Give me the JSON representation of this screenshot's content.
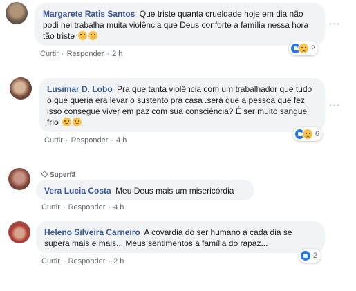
{
  "comments": [
    {
      "author": "Margarete Ratis Santos",
      "text": "Que triste quanta crueldade hoje em dia não podi nei trabalha muita violência que Deus conforte a família nessa hora tão triste",
      "emoji": [
        "sad-face",
        "sad-face"
      ],
      "actions": {
        "like": "Curtir",
        "reply": "Responder",
        "time": "2 h"
      },
      "reactions": {
        "icons": [
          "like",
          "sad"
        ],
        "count": "2"
      },
      "more": "···"
    },
    {
      "author": "Lusimar D. Lobo",
      "text": "Pra que tanta violência com um trabalhador que tudo o que queria era levar o sustento pra casa .será que a pessoa que fez isso consegue viver em paz com sua consciência? É ser muito sangue frio",
      "emoji": [
        "sad-face",
        "sad-face"
      ],
      "actions": {
        "like": "Curtir",
        "reply": "Responder",
        "time": "4 h"
      },
      "reactions": {
        "icons": [
          "like",
          "sad"
        ],
        "count": "6"
      },
      "more": "···"
    },
    {
      "badge": "Superfã",
      "author": "Vera Lucia Costa",
      "text": "Meu Deus mais um misericórdia",
      "actions": {
        "like": "Curtir",
        "reply": "Responder",
        "time": "4 h"
      }
    },
    {
      "author": "Heleno Silveira Carneiro",
      "text": "A covardia do ser humano a cada dia se supera mais e mais... Meus sentimentos a família do rapaz...",
      "actions": {
        "like": "Curtir",
        "reply": "Responder",
        "time": "2 h"
      },
      "reactions": {
        "icons": [
          "like"
        ],
        "count": "2"
      }
    }
  ]
}
